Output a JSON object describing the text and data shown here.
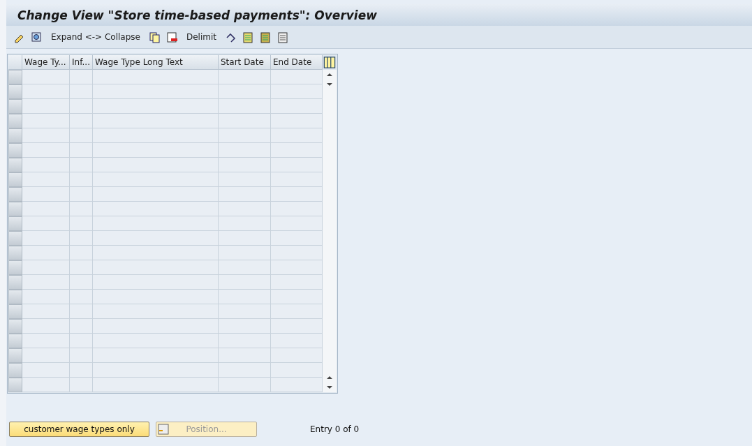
{
  "window": {
    "title": "Change View \"Store time-based payments\": Overview"
  },
  "toolbar": [
    "Expand <-> Collapse",
    "Delimit"
  ],
  "table": {
    "columns": [
      "Wage Ty...",
      "Inf...",
      "Wage Type Long Text",
      "Start Date",
      "End Date"
    ]
  },
  "buttons": [
    {
      "label": "customer wage types only",
      "disabled": false
    },
    {
      "label": "Position...",
      "disabled": true
    }
  ],
  "status": "Entry 0 of 0"
}
